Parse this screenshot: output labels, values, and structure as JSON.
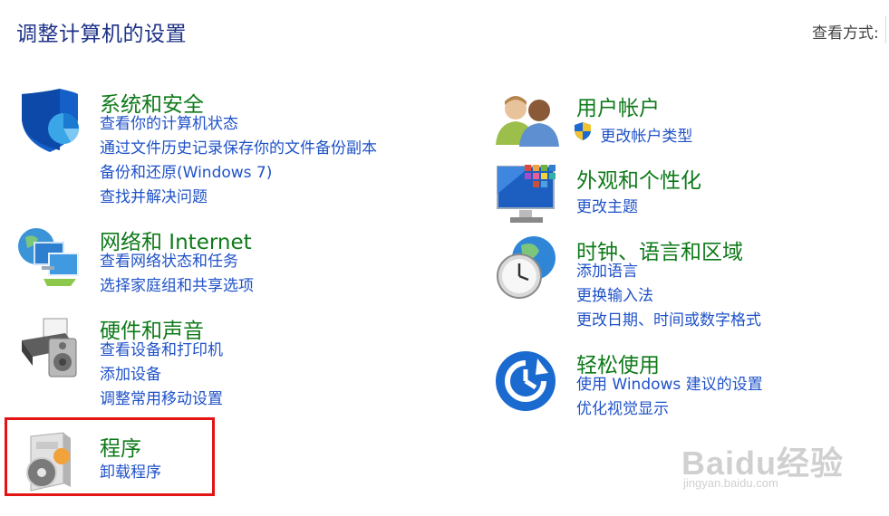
{
  "header": {
    "title": "调整计算机的设置",
    "view_by_label": "查看方式:"
  },
  "categories_left": [
    {
      "title": "系统和安全",
      "icon": "shield-icon",
      "links": [
        "查看你的计算机状态",
        "通过文件历史记录保存你的文件备份副本",
        "备份和还原(Windows 7)",
        "查找并解决问题"
      ]
    },
    {
      "title": "网络和 Internet",
      "icon": "network-globe-icon",
      "links": [
        "查看网络状态和任务",
        "选择家庭组和共享选项"
      ]
    },
    {
      "title": "硬件和声音",
      "icon": "printer-speaker-icon",
      "links": [
        "查看设备和打印机",
        "添加设备",
        "调整常用移动设置"
      ]
    },
    {
      "title": "程序",
      "icon": "programs-disc-icon",
      "links": [
        "卸载程序"
      ]
    }
  ],
  "categories_right": [
    {
      "title": "用户帐户",
      "icon": "users-icon",
      "links": [
        "更改帐户类型"
      ]
    },
    {
      "title": "外观和个性化",
      "icon": "monitor-color-icon",
      "links": [
        "更改主题"
      ]
    },
    {
      "title": "时钟、语言和区域",
      "icon": "clock-globe-icon",
      "links": [
        "添加语言",
        "更换输入法",
        "更改日期、时间或数字格式"
      ]
    },
    {
      "title": "轻松使用",
      "icon": "ease-of-access-icon",
      "links": [
        "使用 Windows 建议的设置",
        "优化视觉显示"
      ]
    }
  ],
  "watermark": {
    "main": "Baidu经验",
    "sub": "jingyan.baidu.com"
  },
  "colors": {
    "title_green": "#0f7a1a",
    "link_blue": "#1f52c8",
    "header_blue": "#1e3287",
    "highlight_red": "#e41414"
  }
}
